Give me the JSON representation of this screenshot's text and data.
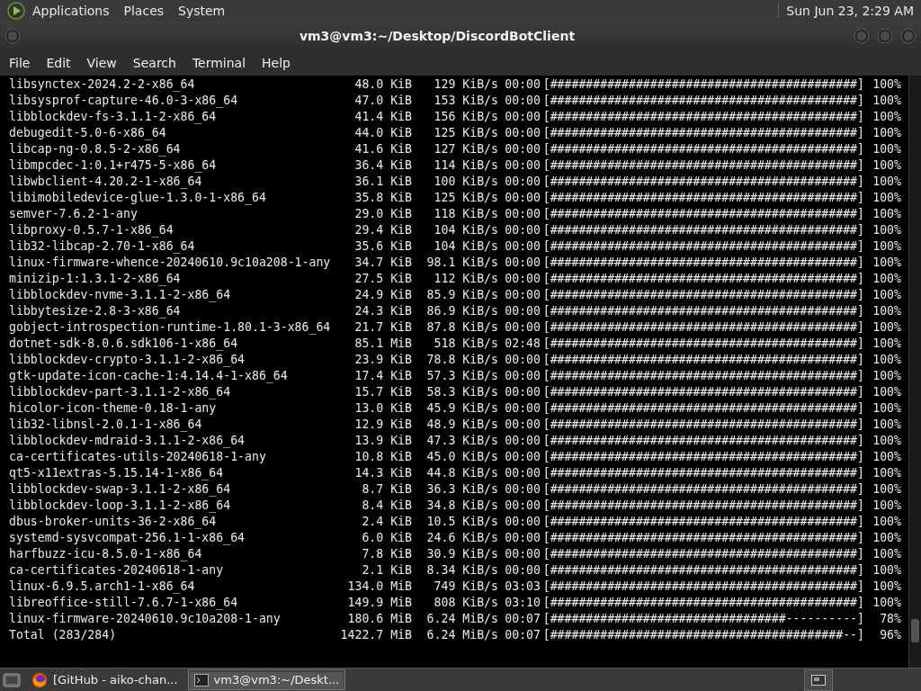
{
  "top_panel": {
    "menus": [
      "Applications",
      "Places",
      "System"
    ],
    "clock": "Sun Jun 23,  2:29 AM"
  },
  "window": {
    "title": "vm3@vm3:~/Desktop/DiscordBotClient",
    "menu": [
      "File",
      "Edit",
      "View",
      "Search",
      "Terminal",
      "Help"
    ]
  },
  "terminal": {
    "rows": [
      {
        "package": "libsynctex-2024.2-2-x86_64",
        "size": "48.0 KiB",
        "rate": "129 KiB/s",
        "eta": "00:00",
        "bar": "[###########################################]",
        "percent": "100%"
      },
      {
        "package": "libsysprof-capture-46.0-3-x86_64",
        "size": "47.0 KiB",
        "rate": "153 KiB/s",
        "eta": "00:00",
        "bar": "[###########################################]",
        "percent": "100%"
      },
      {
        "package": "libblockdev-fs-3.1.1-2-x86_64",
        "size": "41.4 KiB",
        "rate": "156 KiB/s",
        "eta": "00:00",
        "bar": "[###########################################]",
        "percent": "100%"
      },
      {
        "package": "debugedit-5.0-6-x86_64",
        "size": "44.0 KiB",
        "rate": "125 KiB/s",
        "eta": "00:00",
        "bar": "[###########################################]",
        "percent": "100%"
      },
      {
        "package": "libcap-ng-0.8.5-2-x86_64",
        "size": "41.6 KiB",
        "rate": "127 KiB/s",
        "eta": "00:00",
        "bar": "[###########################################]",
        "percent": "100%"
      },
      {
        "package": "libmpcdec-1:0.1+r475-5-x86_64",
        "size": "36.4 KiB",
        "rate": "114 KiB/s",
        "eta": "00:00",
        "bar": "[###########################################]",
        "percent": "100%"
      },
      {
        "package": "libwbclient-4.20.2-1-x86_64",
        "size": "36.1 KiB",
        "rate": "100 KiB/s",
        "eta": "00:00",
        "bar": "[###########################################]",
        "percent": "100%"
      },
      {
        "package": "libimobiledevice-glue-1.3.0-1-x86_64",
        "size": "35.8 KiB",
        "rate": "125 KiB/s",
        "eta": "00:00",
        "bar": "[###########################################]",
        "percent": "100%"
      },
      {
        "package": "semver-7.6.2-1-any",
        "size": "29.0 KiB",
        "rate": "118 KiB/s",
        "eta": "00:00",
        "bar": "[###########################################]",
        "percent": "100%"
      },
      {
        "package": "libproxy-0.5.7-1-x86_64",
        "size": "29.4 KiB",
        "rate": "104 KiB/s",
        "eta": "00:00",
        "bar": "[###########################################]",
        "percent": "100%"
      },
      {
        "package": "lib32-libcap-2.70-1-x86_64",
        "size": "35.6 KiB",
        "rate": "104 KiB/s",
        "eta": "00:00",
        "bar": "[###########################################]",
        "percent": "100%"
      },
      {
        "package": "linux-firmware-whence-20240610.9c10a208-1-any",
        "size": "34.7 KiB",
        "rate": "98.1 KiB/s",
        "eta": "00:00",
        "bar": "[###########################################]",
        "percent": "100%"
      },
      {
        "package": "minizip-1:1.3.1-2-x86_64",
        "size": "27.5 KiB",
        "rate": "112 KiB/s",
        "eta": "00:00",
        "bar": "[###########################################]",
        "percent": "100%"
      },
      {
        "package": "libblockdev-nvme-3.1.1-2-x86_64",
        "size": "24.9 KiB",
        "rate": "85.9 KiB/s",
        "eta": "00:00",
        "bar": "[###########################################]",
        "percent": "100%"
      },
      {
        "package": "libbytesize-2.8-3-x86_64",
        "size": "24.3 KiB",
        "rate": "86.9 KiB/s",
        "eta": "00:00",
        "bar": "[###########################################]",
        "percent": "100%"
      },
      {
        "package": "gobject-introspection-runtime-1.80.1-3-x86_64",
        "size": "21.7 KiB",
        "rate": "87.8 KiB/s",
        "eta": "00:00",
        "bar": "[###########################################]",
        "percent": "100%"
      },
      {
        "package": "dotnet-sdk-8.0.6.sdk106-1-x86_64",
        "size": "85.1 MiB",
        "rate": "518 KiB/s",
        "eta": "02:48",
        "bar": "[###########################################]",
        "percent": "100%"
      },
      {
        "package": "libblockdev-crypto-3.1.1-2-x86_64",
        "size": "23.9 KiB",
        "rate": "78.8 KiB/s",
        "eta": "00:00",
        "bar": "[###########################################]",
        "percent": "100%"
      },
      {
        "package": "gtk-update-icon-cache-1:4.14.4-1-x86_64",
        "size": "17.4 KiB",
        "rate": "57.3 KiB/s",
        "eta": "00:00",
        "bar": "[###########################################]",
        "percent": "100%"
      },
      {
        "package": "libblockdev-part-3.1.1-2-x86_64",
        "size": "15.7 KiB",
        "rate": "58.3 KiB/s",
        "eta": "00:00",
        "bar": "[###########################################]",
        "percent": "100%"
      },
      {
        "package": "hicolor-icon-theme-0.18-1-any",
        "size": "13.0 KiB",
        "rate": "45.9 KiB/s",
        "eta": "00:00",
        "bar": "[###########################################]",
        "percent": "100%"
      },
      {
        "package": "lib32-libnsl-2.0.1-1-x86_64",
        "size": "12.9 KiB",
        "rate": "48.9 KiB/s",
        "eta": "00:00",
        "bar": "[###########################################]",
        "percent": "100%"
      },
      {
        "package": "libblockdev-mdraid-3.1.1-2-x86_64",
        "size": "13.9 KiB",
        "rate": "47.3 KiB/s",
        "eta": "00:00",
        "bar": "[###########################################]",
        "percent": "100%"
      },
      {
        "package": "ca-certificates-utils-20240618-1-any",
        "size": "10.8 KiB",
        "rate": "45.0 KiB/s",
        "eta": "00:00",
        "bar": "[###########################################]",
        "percent": "100%"
      },
      {
        "package": "qt5-x11extras-5.15.14-1-x86_64",
        "size": "14.3 KiB",
        "rate": "44.8 KiB/s",
        "eta": "00:00",
        "bar": "[###########################################]",
        "percent": "100%"
      },
      {
        "package": "libblockdev-swap-3.1.1-2-x86_64",
        "size": "8.7 KiB",
        "rate": "36.3 KiB/s",
        "eta": "00:00",
        "bar": "[###########################################]",
        "percent": "100%"
      },
      {
        "package": "libblockdev-loop-3.1.1-2-x86_64",
        "size": "8.4 KiB",
        "rate": "34.8 KiB/s",
        "eta": "00:00",
        "bar": "[###########################################]",
        "percent": "100%"
      },
      {
        "package": "dbus-broker-units-36-2-x86_64",
        "size": "2.4 KiB",
        "rate": "10.5 KiB/s",
        "eta": "00:00",
        "bar": "[###########################################]",
        "percent": "100%"
      },
      {
        "package": "systemd-sysvcompat-256.1-1-x86_64",
        "size": "6.0 KiB",
        "rate": "24.6 KiB/s",
        "eta": "00:00",
        "bar": "[###########################################]",
        "percent": "100%"
      },
      {
        "package": "harfbuzz-icu-8.5.0-1-x86_64",
        "size": "7.8 KiB",
        "rate": "30.9 KiB/s",
        "eta": "00:00",
        "bar": "[###########################################]",
        "percent": "100%"
      },
      {
        "package": "ca-certificates-20240618-1-any",
        "size": "2.1 KiB",
        "rate": "8.34 KiB/s",
        "eta": "00:00",
        "bar": "[###########################################]",
        "percent": "100%"
      },
      {
        "package": "linux-6.9.5.arch1-1-x86_64",
        "size": "134.0 MiB",
        "rate": "749 KiB/s",
        "eta": "03:03",
        "bar": "[###########################################]",
        "percent": "100%"
      },
      {
        "package": "libreoffice-still-7.6.7-1-x86_64",
        "size": "149.9 MiB",
        "rate": "808 KiB/s",
        "eta": "03:10",
        "bar": "[###########################################]",
        "percent": "100%"
      },
      {
        "package": "linux-firmware-20240610.9c10a208-1-any",
        "size": "180.6 MiB",
        "rate": "6.24 MiB/s",
        "eta": "00:07",
        "bar": "[#################################----------]",
        "percent": "78%"
      },
      {
        "package": "Total (283/284)",
        "size": "1422.7 MiB",
        "rate": "6.24 MiB/s",
        "eta": "00:07",
        "bar": "[#########################################--]",
        "percent": "96%"
      }
    ]
  },
  "taskbar": {
    "tasks": [
      {
        "kind": "browser",
        "label": "[GitHub - aiko-chan...",
        "selected": false
      },
      {
        "kind": "terminal",
        "label": "vm3@vm3:~/Deskt...",
        "selected": true
      }
    ]
  }
}
